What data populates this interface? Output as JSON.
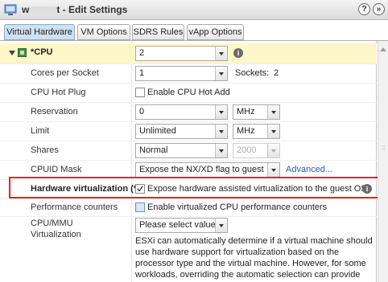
{
  "window": {
    "title_prefix": "w",
    "title_suffix": "t - Edit Settings",
    "help_glyph": "?",
    "expand_glyph": "»"
  },
  "tabs": [
    {
      "label": "Virtual Hardware",
      "active": true
    },
    {
      "label": "VM Options",
      "active": false
    },
    {
      "label": "SDRS Rules",
      "active": false
    },
    {
      "label": "vApp Options",
      "active": false
    }
  ],
  "cpu": {
    "label": "*CPU",
    "value": "2",
    "info": "i",
    "cores_label": "Cores per Socket",
    "cores_value": "1",
    "sockets_label": "Sockets:",
    "sockets_value": "2",
    "hotplug_label": "CPU Hot Plug",
    "hotplug_text": "Enable CPU Hot Add",
    "hotplug_checked": false,
    "reservation_label": "Reservation",
    "reservation_value": "0",
    "reservation_unit": "MHz",
    "limit_label": "Limit",
    "limit_value": "Unlimited",
    "limit_unit": "MHz",
    "shares_label": "Shares",
    "shares_value": "Normal",
    "shares_number": "2000",
    "cpuid_label": "CPUID Mask",
    "cpuid_value": "Expose the NX/XD flag to guest",
    "cpuid_advanced": "Advanced...",
    "hwvirt_label": "Hardware virtualization (*)",
    "hwvirt_text": "Expose hardware assisted virtualization to the guest OS",
    "hwvirt_checked": true,
    "hwvirt_info": "i",
    "perf_label": "Performance counters",
    "perf_text": "Enable virtualized CPU performance counters",
    "perf_checked": false,
    "mmu_label_line1": "CPU/MMU",
    "mmu_label_line2": "Virtualization",
    "mmu_value": "Please select value ...",
    "mmu_desc_1": "ESXi can automatically determine if a virtual machine should",
    "mmu_desc_2": "use hardware support for virtualization based on the",
    "mmu_desc_3": "processor type and the virtual machine. However, for some",
    "mmu_desc_4": "workloads, overriding the automatic selection can provide"
  },
  "colors": {
    "active_tab": "#cfe0f1",
    "cpu_row_bg": "#fdf6c9",
    "highlight_border": "#e8202a",
    "link": "#2a5db0"
  },
  "icons": {
    "window": "vm-icon",
    "expand": "triangle-down-icon",
    "cpu": "cpu-chip-icon"
  }
}
